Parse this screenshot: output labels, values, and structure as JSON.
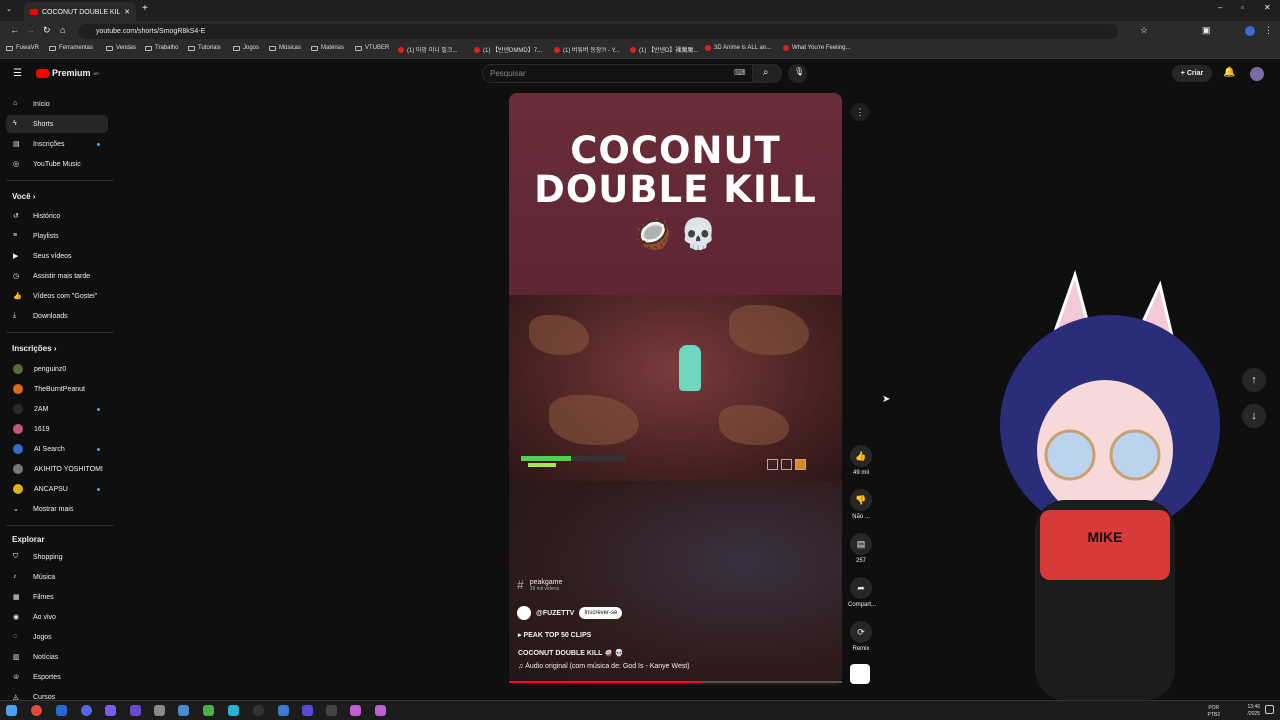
{
  "browser": {
    "tab_title": "COCONUT DOUBLE KILL 🥥 💀",
    "url": "youtube.com/shorts/SmogR8kS4-E",
    "bookmarks": [
      "FuwaVR",
      "Ferramentas",
      "Vendas",
      "Trabalho",
      "Tutoriais",
      "Jogos",
      "Músicas",
      "Matérias",
      "VTUBER",
      "(1) 마망 미니 필크...",
      "(1) 【반넨DMMD】7...",
      "(1) 버튜버 등장?! - Y...",
      "(1) 【반넨D】裸魔魔...",
      "3D Anime is ALL an...",
      "What You're Feeling..."
    ]
  },
  "header": {
    "logo_text": "Premium",
    "logo_sup": "BR",
    "search_placeholder": "Pesquisar",
    "create_label": "Criar"
  },
  "sidebar": {
    "main": [
      {
        "label": "Início",
        "icon": "home-icon"
      },
      {
        "label": "Shorts",
        "icon": "shorts-icon"
      },
      {
        "label": "Inscrições",
        "icon": "subscriptions-icon"
      },
      {
        "label": "YouTube Music",
        "icon": "music-icon"
      }
    ],
    "you_heading": "Você",
    "you": [
      {
        "label": "Histórico"
      },
      {
        "label": "Playlists"
      },
      {
        "label": "Seus vídeos"
      },
      {
        "label": "Assistir mais tarde"
      },
      {
        "label": "Vídeos com \"Gostei\""
      },
      {
        "label": "Downloads"
      }
    ],
    "subs_heading": "Inscrições",
    "subs": [
      {
        "label": "penguinz0",
        "color": "#5a6b3a"
      },
      {
        "label": "TheBurntPeanut",
        "color": "#d96a1a"
      },
      {
        "label": "2AM",
        "color": "#2a2a2a"
      },
      {
        "label": "1619",
        "color": "#c05a80"
      },
      {
        "label": "AI Search",
        "color": "#3a6ad0"
      },
      {
        "label": "AKIHITO YOSHITOMI",
        "color": "#777777"
      },
      {
        "label": "ANCAPSU",
        "color": "#d9b21a"
      },
      {
        "label": "Mostrar mais"
      }
    ],
    "explore_heading": "Explorar",
    "explore": [
      {
        "label": "Shopping"
      },
      {
        "label": "Música"
      },
      {
        "label": "Filmes"
      },
      {
        "label": "Ao vivo"
      },
      {
        "label": "Jogos"
      },
      {
        "label": "Notícias"
      },
      {
        "label": "Esportes"
      },
      {
        "label": "Cursos"
      }
    ]
  },
  "video": {
    "title_line1": "COCONUT",
    "title_line2": "DOUBLE KILL",
    "emojis": "🥥 💀",
    "hashtag": "peakgame",
    "hashtag_sub": "39 mil vídeos",
    "channel": "@FUZETTV",
    "subscribe": "Inscrever-se",
    "playlist": "PEAK TOP 50 CLIPS",
    "caption": "COCONUT DOUBLE KILL 🥥 💀",
    "audio": "Áudio original (com música de: God Is - Kanye West)",
    "health_fraction": 0.48,
    "progress_fraction": 0.58
  },
  "actions": {
    "likes": "49 mil",
    "dislike": "Não ...",
    "comments": "257",
    "share": "Compart...",
    "remix": "Remix"
  },
  "taskbar": {
    "lang1": "POR",
    "lang2": "PTB2",
    "time": "13:46",
    "date": "/2025"
  },
  "colors": {
    "accent": "#ff0000",
    "progress": "#ff0033",
    "subscribe_dot": "#3ea6ff"
  }
}
